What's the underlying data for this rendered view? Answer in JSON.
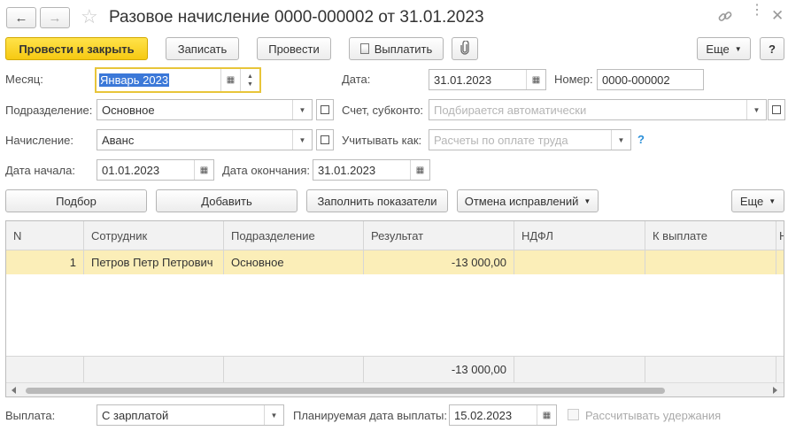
{
  "window": {
    "title": "Разовое начисление 0000-000002 от 31.01.2023"
  },
  "toolbar": {
    "post_close": "Провести и закрыть",
    "save": "Записать",
    "post": "Провести",
    "pay": "Выплатить",
    "more": "Еще",
    "help": "?"
  },
  "form": {
    "month_label": "Месяц:",
    "month_value": "Январь 2023",
    "date_label": "Дата:",
    "date_value": "31.01.2023",
    "number_label": "Номер:",
    "number_value": "0000-000002",
    "division_label": "Подразделение:",
    "division_value": "Основное",
    "account_label": "Счет, субконто:",
    "account_placeholder": "Подбирается автоматически",
    "accrual_label": "Начисление:",
    "accrual_value": "Аванс",
    "consider_label": "Учитывать как:",
    "consider_placeholder": "Расчеты по оплате труда",
    "consider_help": "?",
    "start_label": "Дата начала:",
    "start_value": "01.01.2023",
    "end_label": "Дата окончания:",
    "end_value": "31.01.2023"
  },
  "table_toolbar": {
    "pick": "Подбор",
    "add": "Добавить",
    "fill": "Заполнить показатели",
    "cancel_fix": "Отмена исправлений",
    "more": "Еще"
  },
  "table": {
    "columns": [
      "N",
      "Сотрудник",
      "Подразделение",
      "Результат",
      "НДФЛ",
      "К выплате",
      "Н"
    ],
    "rows": [
      {
        "n": "1",
        "employee": "Петров Петр Петрович",
        "division": "Основное",
        "result": "-13 000,00",
        "ndfl": "",
        "payout": ""
      }
    ],
    "footer": {
      "result": "-13 000,00"
    }
  },
  "bottom": {
    "payment_label": "Выплата:",
    "payment_value": "С зарплатой",
    "planned_label": "Планируемая дата выплаты:",
    "planned_value": "15.02.2023",
    "deductions_label": "Рассчитывать удержания"
  },
  "icons": {
    "back": "arrow-left",
    "forward": "arrow-right",
    "favorite": "star",
    "link": "link",
    "menu": "more-vertical",
    "close": "close",
    "pay": "document",
    "attach": "paperclip",
    "calendar": "calendar",
    "dropdown": "chevron-down",
    "open": "open-form"
  },
  "colors": {
    "accent": "#f6c912",
    "selection": "#fbeeb8",
    "focus_border": "#e8c53a",
    "help": "#2a8fd8"
  }
}
